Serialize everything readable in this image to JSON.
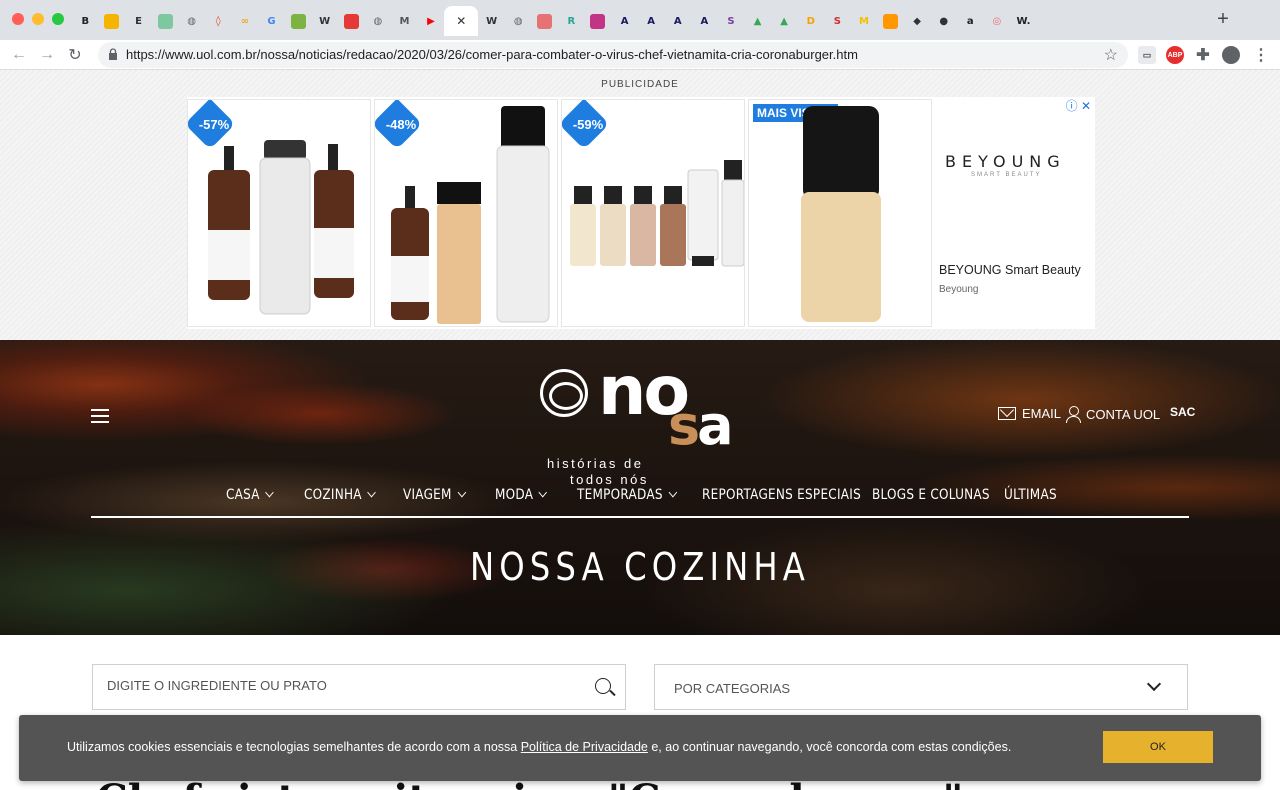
{
  "browser": {
    "tabs": [
      {
        "icon": "b-icon",
        "glyph": "B",
        "color": "#222222"
      },
      {
        "icon": "slides-icon",
        "glyph": "",
        "color": "#f4b400"
      },
      {
        "icon": "e-icon",
        "glyph": "E",
        "color": "#333333"
      },
      {
        "icon": "sheet-icon",
        "glyph": "",
        "color": "#7ec8a0"
      },
      {
        "icon": "globe-icon",
        "glyph": "◍",
        "color": "#666666"
      },
      {
        "icon": "drop-icon",
        "glyph": "◊",
        "color": "#e64a19"
      },
      {
        "icon": "link-icon",
        "glyph": "∞",
        "color": "#f5a623"
      },
      {
        "icon": "google-icon",
        "glyph": "G",
        "color": "#4285f4"
      },
      {
        "icon": "leaf-icon",
        "glyph": "",
        "color": "#7cb342"
      },
      {
        "icon": "wikipedia-icon",
        "glyph": "W",
        "color": "#333333"
      },
      {
        "icon": "bookmark-icon",
        "glyph": "",
        "color": "#e53935"
      },
      {
        "icon": "globe-icon",
        "glyph": "◍",
        "color": "#666666"
      },
      {
        "icon": "medium-icon",
        "glyph": "M",
        "color": "#555555"
      },
      {
        "icon": "youtube-icon",
        "glyph": "▶",
        "color": "#ff0000"
      },
      {
        "icon": "close-icon",
        "glyph": "✕",
        "color": "#333333",
        "active": true
      },
      {
        "icon": "wikipedia-icon",
        "glyph": "W",
        "color": "#333333"
      },
      {
        "icon": "globe-icon",
        "glyph": "◍",
        "color": "#666666"
      },
      {
        "icon": "book-icon",
        "glyph": "",
        "color": "#e57373"
      },
      {
        "icon": "r-icon",
        "glyph": "R",
        "color": "#26a69a"
      },
      {
        "icon": "instagram-icon",
        "glyph": "",
        "color": "#c13584"
      },
      {
        "icon": "a-icon",
        "glyph": "A",
        "color": "#1a1a5e"
      },
      {
        "icon": "a-icon",
        "glyph": "A",
        "color": "#1a1a5e"
      },
      {
        "icon": "a-icon",
        "glyph": "A",
        "color": "#1a1a5e"
      },
      {
        "icon": "a-icon",
        "glyph": "A",
        "color": "#1a1a5e"
      },
      {
        "icon": "s-icon",
        "glyph": "S",
        "color": "#7b3fa0"
      },
      {
        "icon": "drive-icon",
        "glyph": "▲",
        "color": "#34a853"
      },
      {
        "icon": "drive-icon",
        "glyph": "▲",
        "color": "#34a853"
      },
      {
        "icon": "d-icon",
        "glyph": "D",
        "color": "#f4a300"
      },
      {
        "icon": "s-icon",
        "glyph": "S",
        "color": "#d32f2f"
      },
      {
        "icon": "m-icon",
        "glyph": "M",
        "color": "#f2c200"
      },
      {
        "icon": "grid-icon",
        "glyph": "",
        "color": "#ff9800"
      },
      {
        "icon": "diamond-icon",
        "glyph": "◆",
        "color": "#333333"
      },
      {
        "icon": "circle-icon",
        "glyph": "●",
        "color": "#333333"
      },
      {
        "icon": "amazon-icon",
        "glyph": "a",
        "color": "#222222"
      },
      {
        "icon": "target-icon",
        "glyph": "◎",
        "color": "#e57373"
      },
      {
        "icon": "w-icon",
        "glyph": "W.",
        "color": "#222222"
      }
    ],
    "url": "https://www.uol.com.br/nossa/noticias/redacao/2020/03/26/comer-para-combater-o-virus-chef-vietnamita-cria-coronaburger.htm",
    "abp_label": "ABP"
  },
  "ad": {
    "label": "PUBLICIDADE",
    "products": [
      {
        "badge": "-57%"
      },
      {
        "badge": "-48%"
      },
      {
        "badge": "-59%"
      },
      {
        "badge": "MAIS VISTOS"
      }
    ],
    "brand_logo": "BEYOUNG",
    "brand_sub": "SMART BEAUTY",
    "advertiser_name": "BEYOUNG Smart Beauty",
    "advertiser": "Beyoung",
    "adchoices": "ⓘ ✕"
  },
  "site": {
    "logo_top": "no",
    "logo_accent": "s",
    "logo_end": "a",
    "tagline_1": "histórias de",
    "tagline_2": "todos nós",
    "email": "EMAIL",
    "account": "CONTA UOL",
    "sac": "SAC",
    "nav": [
      {
        "label": "CASA",
        "dropdown": true
      },
      {
        "label": "COZINHA",
        "dropdown": true
      },
      {
        "label": "VIAGEM",
        "dropdown": true
      },
      {
        "label": "MODA",
        "dropdown": true
      },
      {
        "label": "TEMPORADAS",
        "dropdown": true
      },
      {
        "label": "REPORTAGENS ESPECIAIS",
        "dropdown": false
      },
      {
        "label": "BLOGS E COLUNAS",
        "dropdown": false
      },
      {
        "label": "ÚLTIMAS",
        "dropdown": false
      }
    ],
    "section_title": "NOSSA COZINHA"
  },
  "search": {
    "placeholder": "DIGITE O INGREDIENTE OU PRATO",
    "category": "POR CATEGORIAS"
  },
  "headline_peek": "Chef vietnamita cria o \"Coronaburger\"",
  "cookie": {
    "text_before": "Utilizamos cookies essenciais e tecnologias semelhantes de acordo com a nossa ",
    "link": "Política de Privacidade",
    "text_after": " e, ao continuar navegando, você concorda com estas condições.",
    "ok": "OK"
  }
}
